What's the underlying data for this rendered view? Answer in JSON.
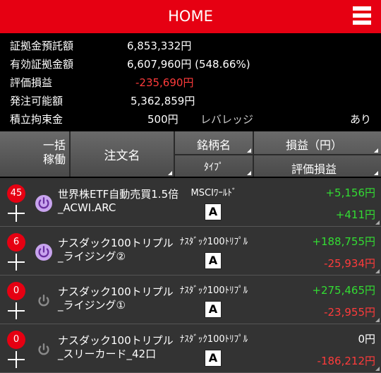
{
  "header": {
    "title": "HOME"
  },
  "summary": {
    "margin_deposit_label": "証拠金預託額",
    "margin_deposit_value": "6,853,332円",
    "effective_margin_label": "有効証拠金額",
    "effective_margin_value": "6,607,960円 (548.66%)",
    "valuation_label": "評価損益",
    "valuation_value": "-235,690円",
    "orderable_label": "発注可能額",
    "orderable_value": "5,362,859円",
    "reserve_label": "積立拘束金",
    "reserve_value": "500円",
    "leverage_label": "レバレッジ",
    "leverage_value": "あり"
  },
  "table_header": {
    "bulk_line1": "一括",
    "bulk_line2": "稼働",
    "order_name": "注文名",
    "brand": "銘柄名",
    "type": "ﾀｲﾌﾟ",
    "pnl": "損益（円）",
    "valuation": "評価損益"
  },
  "rows": [
    {
      "count": "45",
      "active": true,
      "name1": "世界株ETF自動売買1.5倍",
      "name2": "_ACWI.ARC",
      "brand": "MSCIﾜｰﾙﾄﾞ",
      "type": "A",
      "pnl": "+5,156円",
      "pnl_color": "#33dd33",
      "valuation": "+411円",
      "val_color": "#33dd33"
    },
    {
      "count": "6",
      "active": true,
      "name1": "ナスダック100トリプル",
      "name2": "_ライジング②",
      "brand": "ﾅｽﾀﾞｯｸ100ﾄﾘﾌﾟﾙ",
      "type": "A",
      "pnl": "+188,755円",
      "pnl_color": "#33dd33",
      "valuation": "-25,934円",
      "val_color": "#ff3b3b"
    },
    {
      "count": "0",
      "active": false,
      "name1": "ナスダック100トリプル",
      "name2": "_ライジング①",
      "brand": "ﾅｽﾀﾞｯｸ100ﾄﾘﾌﾟﾙ",
      "type": "A",
      "pnl": "+275,465円",
      "pnl_color": "#33dd33",
      "valuation": "-23,955円",
      "val_color": "#ff3b3b"
    },
    {
      "count": "0",
      "active": false,
      "name1": "ナスダック100トリプル",
      "name2": "_スリーカード_42口",
      "brand": "ﾅｽﾀﾞｯｸ100ﾄﾘﾌﾟﾙ",
      "type": "A",
      "pnl": "0円",
      "pnl_color": "#ffffff",
      "valuation": "-186,212円",
      "val_color": "#ff3b3b"
    }
  ],
  "colors": {
    "accent": "#e60012",
    "positive": "#33dd33",
    "negative": "#ff3b3b",
    "power_on": "#9b59d0",
    "power_off": "#888888"
  }
}
